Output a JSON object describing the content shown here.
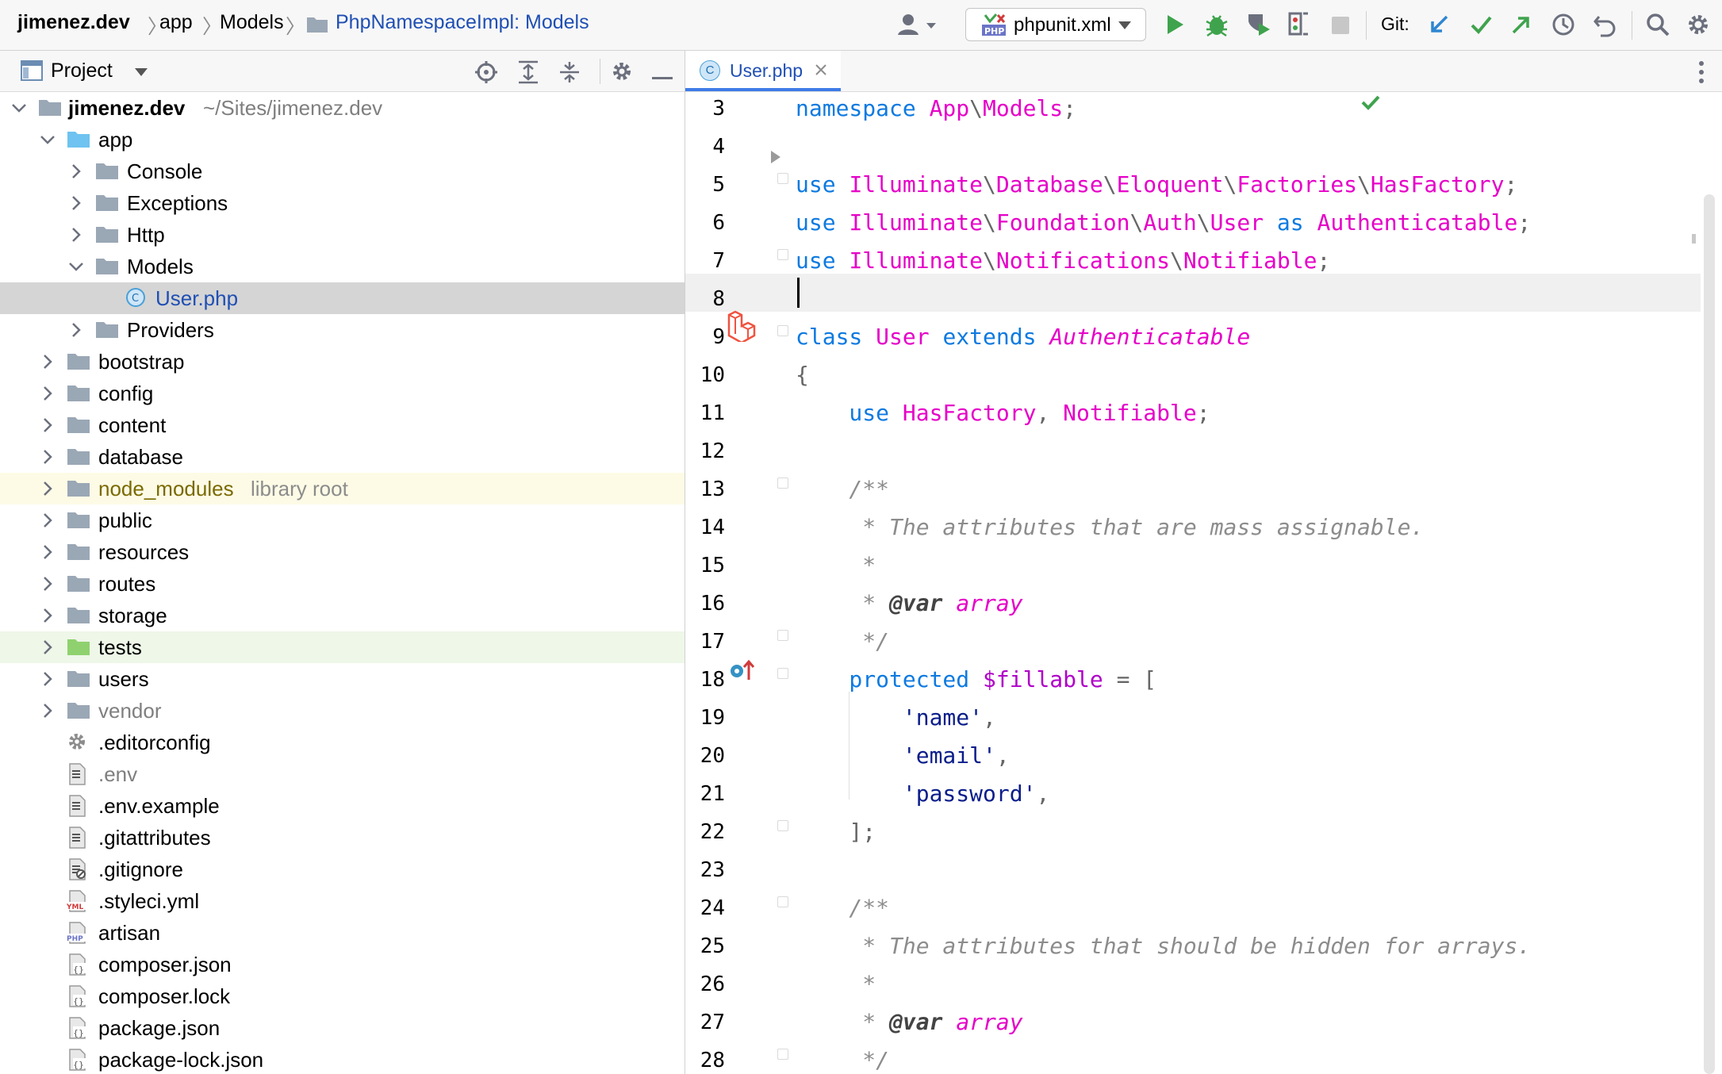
{
  "navbar": {
    "breadcrumbs": [
      "jimenez.dev",
      "app",
      "Models",
      "PhpNamespaceImpl: Models"
    ],
    "run_config": "phpunit.xml",
    "run_config_badge": "PHP",
    "git_label": "Git:"
  },
  "project": {
    "title": "Project",
    "root": {
      "name": "jimenez.dev",
      "path": "~/Sites/jimenez.dev"
    },
    "tree": [
      {
        "label": "app",
        "kind": "folder-blue",
        "arrow": "down"
      },
      {
        "label": "Console",
        "kind": "folder",
        "arrow": "right"
      },
      {
        "label": "Exceptions",
        "kind": "folder",
        "arrow": "right"
      },
      {
        "label": "Http",
        "kind": "folder",
        "arrow": "right"
      },
      {
        "label": "Models",
        "kind": "folder",
        "arrow": "down"
      },
      {
        "label": "User.php",
        "kind": "php-class",
        "arrow": ""
      },
      {
        "label": "Providers",
        "kind": "folder",
        "arrow": "right"
      },
      {
        "label": "bootstrap",
        "kind": "folder",
        "arrow": "right"
      },
      {
        "label": "config",
        "kind": "folder",
        "arrow": "right"
      },
      {
        "label": "content",
        "kind": "folder",
        "arrow": "right"
      },
      {
        "label": "database",
        "kind": "folder",
        "arrow": "right"
      },
      {
        "label": "node_modules",
        "kind": "folder",
        "arrow": "right",
        "suffix": "library root"
      },
      {
        "label": "public",
        "kind": "folder",
        "arrow": "right"
      },
      {
        "label": "resources",
        "kind": "folder",
        "arrow": "right"
      },
      {
        "label": "routes",
        "kind": "folder",
        "arrow": "right"
      },
      {
        "label": "storage",
        "kind": "folder",
        "arrow": "right"
      },
      {
        "label": "tests",
        "kind": "folder-green",
        "arrow": "right"
      },
      {
        "label": "users",
        "kind": "folder",
        "arrow": "right"
      },
      {
        "label": "vendor",
        "kind": "folder",
        "arrow": "right"
      },
      {
        "label": ".editorconfig",
        "kind": "gear-file",
        "arrow": ""
      },
      {
        "label": ".env",
        "kind": "text-file",
        "arrow": ""
      },
      {
        "label": ".env.example",
        "kind": "text-file",
        "arrow": ""
      },
      {
        "label": ".gitattributes",
        "kind": "text-file",
        "arrow": ""
      },
      {
        "label": ".gitignore",
        "kind": "ignore-file",
        "arrow": ""
      },
      {
        "label": ".styleci.yml",
        "kind": "yml-file",
        "arrow": ""
      },
      {
        "label": "artisan",
        "kind": "php-file",
        "arrow": ""
      },
      {
        "label": "composer.json",
        "kind": "json-file",
        "arrow": ""
      },
      {
        "label": "composer.lock",
        "kind": "json-file",
        "arrow": ""
      },
      {
        "label": "package.json",
        "kind": "json-file",
        "arrow": ""
      },
      {
        "label": "package-lock.json",
        "kind": "json-file",
        "arrow": ""
      }
    ]
  },
  "editor": {
    "tab": {
      "title": "User.php",
      "icon": "C"
    },
    "lines": [
      {
        "n": "3",
        "tokens": [
          [
            "kw",
            "namespace "
          ],
          [
            "ns",
            "App"
          ],
          [
            "sep",
            "\\"
          ],
          [
            "ns",
            "Models"
          ],
          [
            "sep",
            ";"
          ]
        ]
      },
      {
        "n": "4",
        "tokens": []
      },
      {
        "n": "5",
        "tokens": [
          [
            "kw",
            "use "
          ],
          [
            "ns",
            "Illuminate"
          ],
          [
            "sep",
            "\\"
          ],
          [
            "ns",
            "Database"
          ],
          [
            "sep",
            "\\"
          ],
          [
            "ns",
            "Eloquent"
          ],
          [
            "sep",
            "\\"
          ],
          [
            "ns",
            "Factories"
          ],
          [
            "sep",
            "\\"
          ],
          [
            "ns",
            "HasFactory"
          ],
          [
            "sep",
            ";"
          ]
        ]
      },
      {
        "n": "6",
        "tokens": [
          [
            "kw",
            "use "
          ],
          [
            "ns",
            "Illuminate"
          ],
          [
            "sep",
            "\\"
          ],
          [
            "ns",
            "Foundation"
          ],
          [
            "sep",
            "\\"
          ],
          [
            "ns",
            "Auth"
          ],
          [
            "sep",
            "\\"
          ],
          [
            "ns",
            "User"
          ],
          [
            "kw",
            " as "
          ],
          [
            "ns",
            "Authenticatable"
          ],
          [
            "sep",
            ";"
          ]
        ]
      },
      {
        "n": "7",
        "tokens": [
          [
            "kw",
            "use "
          ],
          [
            "ns",
            "Illuminate"
          ],
          [
            "sep",
            "\\"
          ],
          [
            "ns",
            "Notifications"
          ],
          [
            "sep",
            "\\"
          ],
          [
            "ns",
            "Notifiable"
          ],
          [
            "sep",
            ";"
          ]
        ]
      },
      {
        "n": "8",
        "tokens": []
      },
      {
        "n": "9",
        "tokens": [
          [
            "kw",
            "class "
          ],
          [
            "nm",
            "User "
          ],
          [
            "kw",
            "extends "
          ],
          [
            "it",
            "Authenticatable"
          ]
        ]
      },
      {
        "n": "10",
        "tokens": [
          [
            "sep",
            "{"
          ]
        ]
      },
      {
        "n": "11",
        "tokens": [
          [
            "kw",
            "    use "
          ],
          [
            "nm",
            "HasFactory"
          ],
          [
            "sep",
            ", "
          ],
          [
            "nm",
            "Notifiable"
          ],
          [
            "sep",
            ";"
          ]
        ]
      },
      {
        "n": "12",
        "tokens": []
      },
      {
        "n": "13",
        "tokens": [
          [
            "cm",
            "    /**"
          ]
        ]
      },
      {
        "n": "14",
        "tokens": [
          [
            "cm",
            "     * The attributes that are mass assignable."
          ]
        ]
      },
      {
        "n": "15",
        "tokens": [
          [
            "cm",
            "     *"
          ]
        ]
      },
      {
        "n": "16",
        "tokens": [
          [
            "cm",
            "     * "
          ],
          [
            "tag",
            "@var "
          ],
          [
            "it",
            "array"
          ]
        ]
      },
      {
        "n": "17",
        "tokens": [
          [
            "cm",
            "     */"
          ]
        ]
      },
      {
        "n": "18",
        "tokens": [
          [
            "kw",
            "    protected "
          ],
          [
            "var",
            "$fillable"
          ],
          [
            "sep",
            " = ["
          ]
        ]
      },
      {
        "n": "19",
        "tokens": [
          [
            "str",
            "        'name'"
          ],
          [
            "sep",
            ","
          ]
        ]
      },
      {
        "n": "20",
        "tokens": [
          [
            "str",
            "        'email'"
          ],
          [
            "sep",
            ","
          ]
        ]
      },
      {
        "n": "21",
        "tokens": [
          [
            "str",
            "        'password'"
          ],
          [
            "sep",
            ","
          ]
        ]
      },
      {
        "n": "22",
        "tokens": [
          [
            "sep",
            "    ];"
          ]
        ]
      },
      {
        "n": "23",
        "tokens": []
      },
      {
        "n": "24",
        "tokens": [
          [
            "cm",
            "    /**"
          ]
        ]
      },
      {
        "n": "25",
        "tokens": [
          [
            "cm",
            "     * The attributes that should be hidden for arrays."
          ]
        ]
      },
      {
        "n": "26",
        "tokens": [
          [
            "cm",
            "     *"
          ]
        ]
      },
      {
        "n": "27",
        "tokens": [
          [
            "cm",
            "     * "
          ],
          [
            "tag",
            "@var "
          ],
          [
            "it",
            "array"
          ]
        ]
      },
      {
        "n": "28",
        "tokens": [
          [
            "cm",
            "     */"
          ]
        ]
      }
    ]
  },
  "colors": {
    "keyword": "#0d7ae0",
    "identifier": "#e600c8",
    "string": "#0a1d8a",
    "comment": "#8c8c8c",
    "accent": "#3e7ce8",
    "run_green": "#3fa34d",
    "git_blue": "#2f86d1"
  },
  "icons": {
    "run": "play-icon",
    "debug": "bug-icon",
    "coverage": "coverage-icon",
    "profile": "profiler-icon",
    "stop": "stop-icon",
    "git_update": "git-update-icon",
    "git_commit": "git-commit-icon",
    "git_push": "git-push-icon",
    "history": "history-icon",
    "rollback": "rollback-icon",
    "search": "search-icon",
    "settings": "gear-icon"
  }
}
